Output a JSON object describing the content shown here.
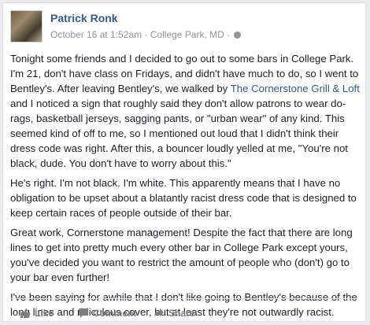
{
  "post": {
    "author": "Patrick Ronk",
    "timestamp": "October 16 at 1:52am",
    "location": "College Park, MD",
    "privacy_icon": "globe-icon",
    "paragraph1_before": "Tonight some friends and I decided to go out to some bars in College Park. I'm 21, don't have class on Fridays, and didn't have much to do, so I went to Bentley's. After leaving Bentley's, we walked by ",
    "paragraph1_link": "The Cornerstone Grill & Loft",
    "paragraph1_after": " and I noticed a sign that roughly said they don't allow patrons to wear do-rags, basketball jerseys, sagging pants, or \"urban wear\" of any kind. This seemed kind of off to me, so I mentioned out loud that I didn't think their dress code was right. After this, a bouncer loudly yelled at me, \"You're not black, dude. You don't have to worry about this.\"",
    "paragraph2": "He's right. I'm not black. I'm white. This apparently means that I have no obligation to be upset about a blatantly racist dress code that is designed to keep certain races of people outside of their bar.",
    "paragraph3": "Great work, Cornerstone management! Despite the fact that there are long lines to get into pretty much every other bar in College Park except yours, you've decided you want to restrict the amount of people who (don't) go to your bar even further!",
    "paragraph4": "I've been saying for awhile that I don't like going to Bentley's because of the long lines and ridiculous cover, but at least they're not outwardly racist."
  },
  "actions": {
    "like_label": "Like",
    "comment_label": "Comment",
    "share_label": "Share"
  },
  "colors": {
    "link": "#365899",
    "text": "#1d2129",
    "meta": "#90949c"
  }
}
